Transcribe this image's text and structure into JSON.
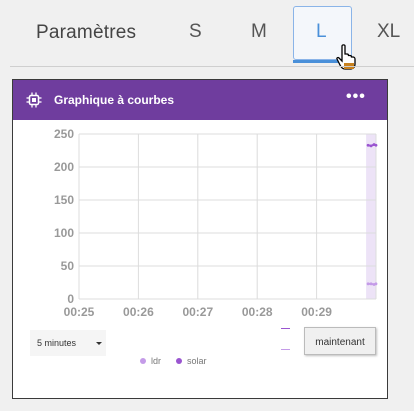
{
  "topbar": {
    "settings_label": "Paramètres",
    "size_tabs": [
      "S",
      "M",
      "L",
      "XL"
    ],
    "active_tab": "L"
  },
  "widget": {
    "title": "Graphique à courbes",
    "menu_icon": "more-dots-icon",
    "header_color": "#6f3d9e"
  },
  "controls": {
    "time_range": "5 minutes",
    "now_button": "maintenant"
  },
  "legend": [
    {
      "name": "ldr",
      "color": "#c49be8"
    },
    {
      "name": "solar",
      "color": "#9a55d0"
    }
  ],
  "chart_data": {
    "type": "line",
    "x_ticks": [
      "00:25",
      "00:26",
      "00:27",
      "00:28",
      "00:29"
    ],
    "y_ticks": [
      "250",
      "200",
      "150",
      "100",
      "50",
      "0"
    ],
    "ylim": [
      0,
      250
    ],
    "xlim": [
      "00:25",
      "00:30"
    ],
    "grid": true,
    "highlight_region": [
      "00:29:50",
      "00:30"
    ],
    "series": [
      {
        "name": "solar",
        "color": "#9a55d0",
        "x": [
          "00:29:52",
          "00:29:55",
          "00:29:58",
          "00:30"
        ],
        "values": [
          233,
          232,
          234,
          233
        ]
      },
      {
        "name": "ldr",
        "color": "#c49be8",
        "x": [
          "00:29:52",
          "00:29:55",
          "00:29:58",
          "00:30"
        ],
        "values": [
          23,
          23,
          22,
          23
        ]
      }
    ]
  }
}
